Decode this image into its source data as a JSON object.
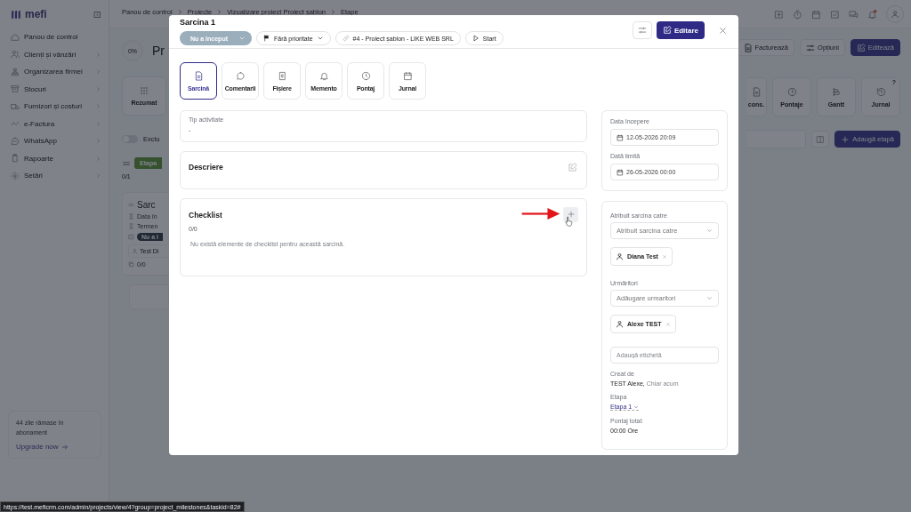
{
  "sidebar": {
    "logo": "mefi",
    "items": [
      {
        "label": "Panou de control",
        "has_submenu": false
      },
      {
        "label": "Clienți și vânzări",
        "has_submenu": true
      },
      {
        "label": "Organizarea firmei",
        "has_submenu": true
      },
      {
        "label": "Stocuri",
        "has_submenu": true
      },
      {
        "label": "Furnizori și costuri",
        "has_submenu": true
      },
      {
        "label": "e-Factura",
        "has_submenu": true
      },
      {
        "label": "WhatsApp",
        "has_submenu": true
      },
      {
        "label": "Rapoarte",
        "has_submenu": true
      },
      {
        "label": "Setări",
        "has_submenu": true
      }
    ],
    "subscription": {
      "note": "44 zile rămase în abonament",
      "link": "Upgrade now"
    }
  },
  "top_bar": {
    "breadcrumb": [
      "Panou de control",
      "Proiecte",
      "Vizualizare proiect Proiect șablon",
      "Etape"
    ]
  },
  "project_left": {
    "progress": "0%",
    "title": "Pr",
    "view_tab": "Rezumat",
    "toggle": {
      "label": "Exclu",
      "on": false
    },
    "stage_badge": "Etapa",
    "stage_count": "0/1",
    "task": {
      "title": "Sarc",
      "lines": [
        "Data în",
        "Termen"
      ],
      "status": "Nu a î",
      "assignee": "Test Di",
      "checklist": "0/0"
    }
  },
  "project_right": {
    "buttons": [
      {
        "label": "Facturează",
        "kind": "outline"
      },
      {
        "label": "Opțiuni",
        "kind": "outline"
      },
      {
        "label": "Editează",
        "kind": "primary"
      }
    ],
    "view_tabs": [
      {
        "label": "cons."
      },
      {
        "label": "Pontaje"
      },
      {
        "label": "Gantt"
      },
      {
        "label": "Jurnal",
        "badge": "?"
      }
    ],
    "add_stage": "Adaugă etapă"
  },
  "modal": {
    "title": "Sarcina 1",
    "status": "Nu a început",
    "priority": "Fără prioritate",
    "project_link": "#4 - Proiect șablon - LIKE WEB SRL",
    "start": "Start",
    "edit_button": "Editare",
    "tabs": [
      {
        "label": "Sarcină",
        "selected": true
      },
      {
        "label": "Comentarii",
        "selected": false
      },
      {
        "label": "Fișiere",
        "selected": false
      },
      {
        "label": "Memento",
        "selected": false
      },
      {
        "label": "Pontaj",
        "selected": false
      },
      {
        "label": "Jurnal",
        "selected": false
      }
    ],
    "activity": {
      "label": "Tip activitate",
      "value": "-"
    },
    "description": {
      "title": "Descriere"
    },
    "checklist": {
      "title": "Checklist",
      "count": "0/0",
      "empty": "Nu există elemente de checklist pentru această sarcină."
    },
    "dates": [
      {
        "label": "Data începere",
        "value": "12-05-2026 20:09"
      },
      {
        "label": "Dată limită",
        "value": "26-05-2026 00:00"
      }
    ],
    "assign": {
      "label": "Atribuit sarcina catre",
      "placeholder": "Atribuit sarcina catre",
      "people": [
        "Diana Test"
      ]
    },
    "followers": {
      "label": "Urmăritori",
      "placeholder": "Adăugare urmaritori",
      "people": [
        "Alexe TEST"
      ]
    },
    "tag_placeholder": "Adaugă etichetă",
    "created": {
      "label": "Creat de",
      "author": "TEST Alexe,",
      "time": "Chiar acum"
    },
    "stage": {
      "label": "Etapa",
      "value": "Etapa 1"
    },
    "time_total": {
      "label": "Pontaj total:",
      "value": "00:00 Ore"
    }
  },
  "status_bar": {
    "url": "https://test.meficrm.com/admin/projects/view/4?group=project_milestones&taskid=82#"
  }
}
